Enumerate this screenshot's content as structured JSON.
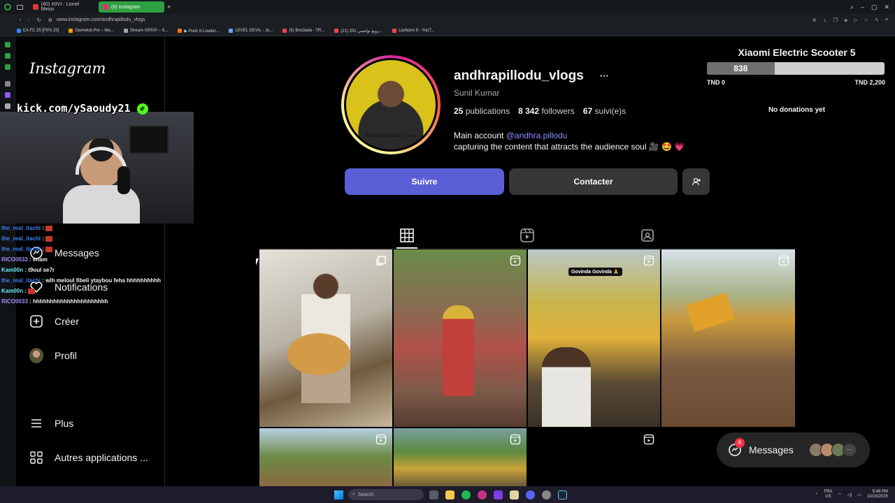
{
  "browser": {
    "tabs": [
      {
        "label": "(40) XIIVI - Lionel Messi",
        "active": false
      },
      {
        "label": "(8) Instagram",
        "active": true
      }
    ],
    "url": "www.instagram.com/andhrapillodu_vlogs",
    "bookmarks": [
      "EA FC 25 [FIFA 25]",
      "Gamekot.Pro – Mo...",
      "Stream GRIV0 – S...",
      "▶ Push It Louder...",
      "LEVEL DEVIL - Jo...",
      "(5) Bos3ada - TR...",
      "(21) روبع توانسي 201...",
      "Lashpiro 9 - YouT..."
    ]
  },
  "sidebar": {
    "logo": "Instagram",
    "items": [
      {
        "label": "Messages",
        "icon": "messenger-icon"
      },
      {
        "label": "Notifications",
        "icon": "heart-icon"
      },
      {
        "label": "Créer",
        "icon": "plus-square-icon"
      },
      {
        "label": "Profil",
        "icon": "avatar"
      },
      {
        "label": "Plus",
        "icon": "menu-icon"
      },
      {
        "label": "Autres applications ...",
        "icon": "apps-icon"
      }
    ]
  },
  "profile": {
    "username": "andhrapillodu_vlogs",
    "full_name": "Sunil Kumar",
    "posts_count": "25",
    "posts_label": "publications",
    "followers_count": "8 342",
    "followers_label": "followers",
    "following_count": "67",
    "following_label": "suivi(e)s",
    "bio_prefix": "Main account",
    "bio_mention": "@andhra.pillodu",
    "bio_line2": "capturing the content that attracts the audience soul 🎥 🤩 💗",
    "avatar_caption": "Andhrapillodu Vlogs",
    "follow_label": "Suivre",
    "contact_label": "Contacter",
    "more": "···"
  },
  "grid": {
    "posts": [
      {
        "type": "multi",
        "caption": ""
      },
      {
        "type": "reel",
        "caption": ""
      },
      {
        "type": "reel",
        "caption": "Govinda Govinda 🙏"
      },
      {
        "type": "reel",
        "caption": ""
      },
      {
        "type": "reel",
        "caption": ""
      },
      {
        "type": "reel",
        "caption": ""
      },
      {
        "type": "reel",
        "caption": ""
      }
    ]
  },
  "donation": {
    "title": "Xiaomi Electric Scooter 5",
    "current": "838",
    "progress_fraction": 0.38,
    "min": "TND 0",
    "max": "TND 2,200",
    "status": "No donations yet"
  },
  "stream": {
    "kick": "kick.com/ySaoudy21",
    "chat": [
      {
        "user": "the_real_itachi",
        "text": "",
        "color": "#3b82f6"
      },
      {
        "user": "the_real_itachi",
        "text": "",
        "color": "#3b82f6"
      },
      {
        "user": "the_real_itachi",
        "text": "",
        "color": "#3b82f6"
      },
      {
        "user": "RICO0033",
        "text": "enam",
        "color": "#a78bfa"
      },
      {
        "user": "Kam00n",
        "text": "t9oul se7r",
        "color": "#67e8f9"
      },
      {
        "user": "the_real_itachi",
        "text": "wlh meloul fibeli ytaybou feha hhhhhhhhhh",
        "color": "#3b82f6"
      },
      {
        "user": "Kam00n",
        "text": "",
        "color": "#67e8f9"
      },
      {
        "user": "RICO0033",
        "text": "hhhhhhhhhhhhhhhhhhhhhh",
        "color": "#a78bfa"
      }
    ]
  },
  "messages_pill": {
    "label": "Messages",
    "badge": "6",
    "more": "···"
  },
  "taskbar": {
    "search_placeholder": "Search",
    "lang": "FRA",
    "region": "US",
    "time": "5:49 PM",
    "date": "10/15/2025"
  },
  "colors": {
    "follow_button": "#5b5fd6",
    "contact_button": "#363636",
    "link": "#8d8dff",
    "badge": "#ff3040"
  }
}
